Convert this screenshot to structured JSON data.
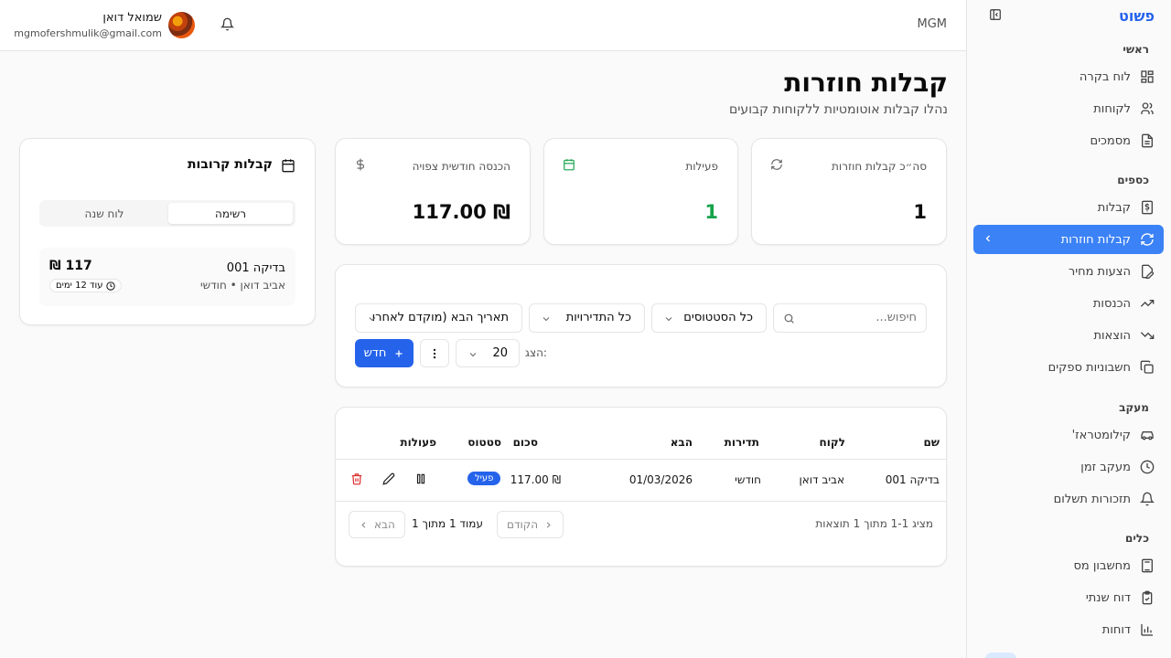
{
  "sidebar": {
    "brand": "פשוט",
    "sections": {
      "main": "ראשי",
      "money": "כספים",
      "tracking": "מעקב",
      "tools": "כלים"
    },
    "items": {
      "dashboard": "לוח בקרה",
      "clients": "לקוחות",
      "documents": "מסמכים",
      "receipts": "קבלות",
      "recurring": "קבלות חוזרות",
      "quotes": "הצעות מחיר",
      "income": "הכנסות",
      "expenses": "הוצאות",
      "supplier_invoices": "חשבוניות ספקים",
      "mileage": "קילומטראז'",
      "time_tracking": "מעקב זמן",
      "payment_reminders": "תזכורות תשלום",
      "tax_calculator": "מחשבון מס",
      "annual_report": "דוח שנתי",
      "reports": "דוחות"
    }
  },
  "header": {
    "workspace": "MGM",
    "user_name": "שמואל דואן",
    "user_email": "mgmofershmulik@gmail.com"
  },
  "page": {
    "title": "קבלות חוזרות",
    "subtitle": "נהלו קבלות אוטומטיות ללקוחות קבועים"
  },
  "stats": {
    "total_label": "סה״כ קבלות חוזרות",
    "total_value": "1",
    "active_label": "פעילות",
    "active_value": "1",
    "monthly_label": "הכנסה חודשית צפויה",
    "monthly_value": "₪ 117.00"
  },
  "filters": {
    "search_placeholder": "חיפוש...",
    "status": "כל הסטטוסים",
    "frequency": "כל התדירויות",
    "sort": "תאריך הבא (מוקדם לאחרו",
    "page_size_label": "הצג:",
    "page_size": "20",
    "new_label": "חדש"
  },
  "table": {
    "headers": {
      "name": "שם",
      "client": "לקוח",
      "frequency": "תדירות",
      "next": "הבא",
      "amount": "סכום",
      "status": "סטטוס",
      "actions": "פעולות"
    },
    "rows": [
      {
        "name": "בדיקה 001",
        "client": "אביב דואן",
        "frequency": "חודשי",
        "next": "01/03/2026",
        "amount": "₪ 117.00",
        "status": "פעיל"
      }
    ],
    "results_info": "מציג 1-1 מתוך 1 תוצאות",
    "prev_label": "הקודם",
    "next_label": "הבא",
    "page_info": "עמוד 1 מתוך 1"
  },
  "upcoming": {
    "title": "קבלות קרובות",
    "tab_list": "רשימה",
    "tab_year": "לוח שנה",
    "item_name": "בדיקה 001",
    "item_sub": "אביב דואן • חודשי",
    "item_amount": "117 ₪",
    "item_due": "עוד 12 ימים"
  },
  "colors": {
    "accent": "#2563eb",
    "active_green": "#16a34a",
    "delete_red": "#dc2626"
  }
}
